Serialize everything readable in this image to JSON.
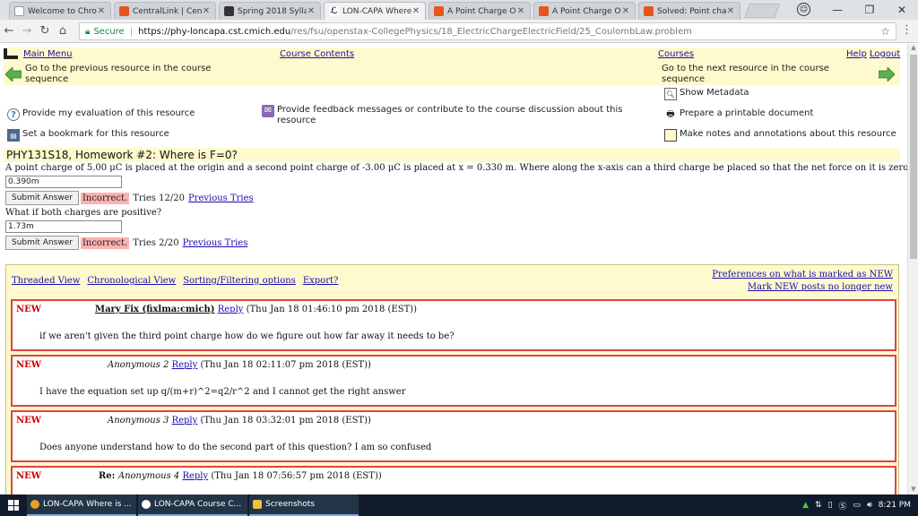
{
  "browser": {
    "tabs": [
      {
        "title": "Welcome to Chron",
        "favicon": "page-icon",
        "color": "#ffffff"
      },
      {
        "title": "CentralLink | Cent",
        "favicon": "centrallink-icon",
        "color": "#e8541e"
      },
      {
        "title": "Spring 2018 Syllab",
        "favicon": "blackboard-icon",
        "color": "#333333"
      },
      {
        "title": "LON-CAPA Where",
        "favicon": "loncapa-icon",
        "color": "#222222",
        "active": true
      },
      {
        "title": "A Point Charge Of",
        "favicon": "chegg-icon",
        "color": "#e8541e"
      },
      {
        "title": "A Point Charge Of",
        "favicon": "chegg-icon",
        "color": "#e8541e"
      },
      {
        "title": "Solved: Point char",
        "favicon": "chegg-icon",
        "color": "#e8541e"
      }
    ],
    "close_glyph": "✕",
    "window_controls": {
      "minimize": "—",
      "maximize": "❐",
      "close": "✕"
    },
    "profile_glyph": "☺",
    "address": {
      "secure_label": "Secure",
      "host": "https://phy-loncapa.cst.cmich.edu",
      "path": "/res/fsu/openstax-CollegePhysics/18_ElectricChargeElectricField/25_CoulombLaw.problem"
    }
  },
  "nav": {
    "main_menu": "Main Menu",
    "course_contents": "Course Contents",
    "courses": "Courses",
    "help": "Help",
    "logout": "Logout",
    "prev_text": "Go to the previous resource in the course sequence",
    "next_text": "Go to the next resource in the course sequence",
    "show_metadata": "Show Metadata",
    "evaluation": "Provide my evaluation of this resource",
    "feedback": "Provide feedback messages or contribute to the course discussion about this resource",
    "printable": "Prepare a printable document",
    "bookmark": "Set a bookmark for this resource",
    "notes": "Make notes and annotations about this resource"
  },
  "problem": {
    "title": "PHY131S18, Homework #2: Where is F=0?",
    "question1": "A point charge of 5.00 μC is placed at the origin and a second point charge of -3.00 μC is placed at x = 0.330 m. Where along the x-axis can a third charge be placed so that the net force on it is zero?",
    "answer1": "0.390m",
    "submit_label": "Submit Answer",
    "status1": "Incorrect.",
    "tries1": "Tries 12/20",
    "prev_tries": "Previous Tries",
    "question2": "What if both charges are positive?",
    "answer2": "1.73m",
    "status2": "Incorrect.",
    "tries2": "Tries 2/20"
  },
  "discussion": {
    "threaded": "Threaded View",
    "chronological": "Chronological View",
    "sorting": "Sorting/Filtering options",
    "export": "Export?",
    "prefs": "Preferences on what is marked as NEW",
    "mark_new": "Mark NEW posts no longer new",
    "posts": [
      {
        "badge": "NEW",
        "author": "Mary Fix (fixlma:cmich)",
        "reply": "Reply",
        "date": "(Thu Jan 18 01:46:10 pm 2018 (EST))",
        "body": "if we aren't given the third point charge how do we figure out how far away it needs to be?"
      },
      {
        "badge": "NEW",
        "author": "Anonymous 2",
        "reply": "Reply",
        "date": "(Thu Jan 18 02:11:07 pm 2018 (EST))",
        "body": "I have the equation set up q/(m+r)^2=q2/r^2 and I cannot get the right answer"
      },
      {
        "badge": "NEW",
        "author": "Anonymous 3",
        "reply": "Reply",
        "date": "(Thu Jan 18 03:32:01 pm 2018 (EST))",
        "body": "Does anyone understand how to do the second part of this question? I am so confused"
      },
      {
        "badge": "NEW",
        "prefix": "Re: ",
        "author": "Anonymous 4",
        "reply": "Reply",
        "date": "(Thu Jan 18 07:56:57 pm 2018 (EST))",
        "body": ""
      }
    ]
  },
  "taskbar": {
    "items": [
      {
        "label": "LON-CAPA Where is ...",
        "icon": "chrome-icon",
        "color": "#e8a020"
      },
      {
        "label": "LON-CAPA Course C...",
        "icon": "loncapa-icon",
        "color": "#ffffff"
      },
      {
        "label": "Screenshots",
        "icon": "folder-icon",
        "color": "#f0c040"
      }
    ],
    "clock": "8:21 PM"
  }
}
